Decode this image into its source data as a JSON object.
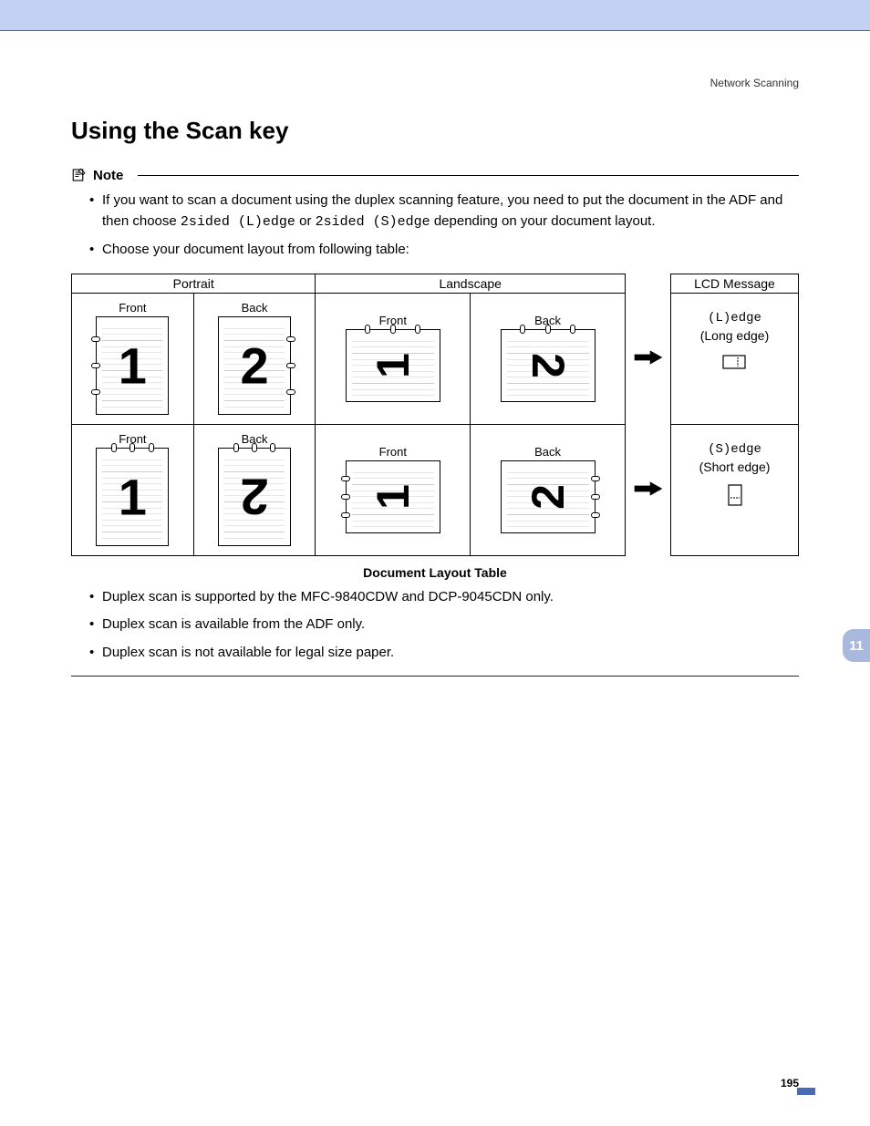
{
  "breadcrumb": "Network Scanning",
  "title": "Using the Scan key",
  "note": {
    "label": "Note",
    "items": [
      {
        "pre": "If you want to scan a document using the duplex scanning feature, you need to put the document in the ADF and then choose ",
        "code1": "2sided (L)edge",
        "mid": " or ",
        "code2": "2sided (S)edge",
        "post": " depending on your document layout."
      },
      {
        "text": "Choose your document layout from following table:"
      }
    ]
  },
  "table": {
    "headers": {
      "portrait": "Portrait",
      "landscape": "Landscape",
      "lcd": "LCD Message"
    },
    "sub": {
      "front": "Front",
      "back": "Back"
    },
    "caption": "Document Layout Table",
    "rows": [
      {
        "portrait_front": "1",
        "portrait_back": "2",
        "landscape_front": "1",
        "landscape_back": "2",
        "lcd_code": "(L)edge",
        "lcd_label": "(Long edge)"
      },
      {
        "portrait_front": "1",
        "portrait_back": "2",
        "landscape_front": "1",
        "landscape_back": "2",
        "lcd_code": "(S)edge",
        "lcd_label": "(Short edge)"
      }
    ]
  },
  "post_bullets": [
    "Duplex scan is supported by the MFC-9840CDW and DCP-9045CDN only.",
    "Duplex scan is available from the ADF only.",
    "Duplex scan is not available for legal size paper."
  ],
  "section_tab": "11",
  "page_number": "195"
}
